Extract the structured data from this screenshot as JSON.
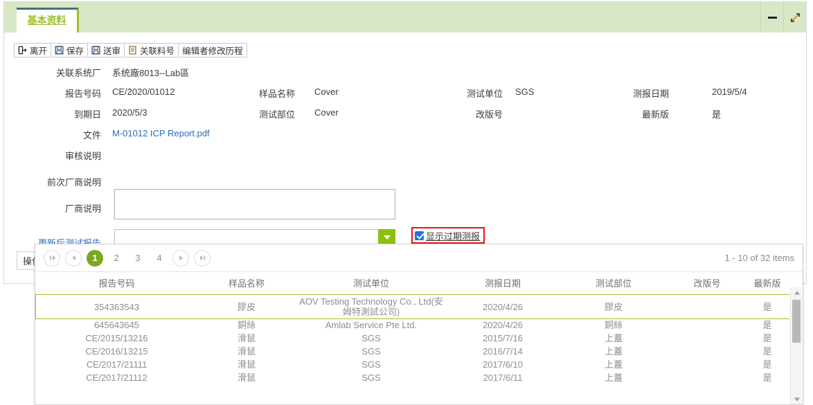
{
  "window": {
    "tab_label": "基本资料",
    "minimize_title": "最小化",
    "maximize_title": "最大化"
  },
  "toolbar": [
    {
      "icon": "exit-icon",
      "label": "离开"
    },
    {
      "icon": "save-icon",
      "label": "保存"
    },
    {
      "icon": "submit-icon",
      "label": "送审"
    },
    {
      "icon": "document-icon",
      "label": "关联料号"
    },
    {
      "icon": "history-icon",
      "label": "编辑者修改历程"
    }
  ],
  "form": {
    "system_factory_label": "关联系统厂",
    "system_factory_value": "系统廠8013--Lab區",
    "report_no_label": "报告号码",
    "report_no_value": "CE/2020/01012",
    "sample_name_label": "样品名称",
    "sample_name_value": "Cover",
    "test_lab_label": "测试单位",
    "test_lab_value": "SGS",
    "report_date_label": "测报日期",
    "report_date_value": "2019/5/4",
    "expiry_label": "到期日",
    "expiry_value": "2020/5/3",
    "test_part_label": "测试部位",
    "test_part_value": "Cover",
    "revision_label": "改版号",
    "revision_value": "",
    "latest_label": "最新版",
    "latest_value": "是",
    "file_label": "文件",
    "file_value": "M-01012 ICP Report.pdf",
    "audit_note_label": "审核说明",
    "audit_note_value": "",
    "prev_vendor_note_label": "前次厂商说明",
    "prev_vendor_note_value": "",
    "vendor_note_label": "厂商说明",
    "vendor_note_value": "",
    "updated_report_label": "更新后测试报告",
    "updated_report_value": "",
    "updated_report_placeholder": "",
    "show_expired_label": "显示过期测报",
    "show_expired_checked": true,
    "ops_label": "操作"
  },
  "dropdown": {
    "pager": {
      "first_icon": "first-page-icon",
      "prev_icon": "prev-page-icon",
      "next_icon": "next-page-icon",
      "last_icon": "last-page-icon",
      "pages": [
        "1",
        "2",
        "3",
        "4"
      ],
      "active_page": "1",
      "info": "1 - 10 of 32 items"
    },
    "grid": {
      "columns": [
        "报告号码",
        "样品名称",
        "测试单位",
        "测报日期",
        "测试部位",
        "改版号",
        "最新版"
      ],
      "rows": [
        {
          "selected": true,
          "cells": [
            "354363543",
            "膠皮",
            "AOV Testing Technology Co., Ltd(安姆特測試公司)",
            "2020/4/26",
            "膠皮",
            "",
            "是"
          ]
        },
        {
          "selected": false,
          "cells": [
            "645643645",
            "銅絲",
            "Amlab Service Pte Ltd.",
            "2020/4/26",
            "銅絲",
            "",
            "是"
          ]
        },
        {
          "selected": false,
          "cells": [
            "CE/2015/13216",
            "滑鼠",
            "SGS",
            "2015/7/16",
            "上蓋",
            "",
            "是"
          ]
        },
        {
          "selected": false,
          "cells": [
            "CE/2016/13215",
            "滑鼠",
            "SGS",
            "2016/7/14",
            "上蓋",
            "",
            "是"
          ]
        },
        {
          "selected": false,
          "cells": [
            "CE/2017/21111",
            "滑鼠",
            "SGS",
            "2017/6/10",
            "上蓋",
            "",
            "是"
          ]
        },
        {
          "selected": false,
          "cells": [
            "CE/2017/21112",
            "滑鼠",
            "SGS",
            "2017/6/11",
            "上蓋",
            "",
            "是"
          ]
        }
      ]
    }
  },
  "colors": {
    "header_band": "#d8e8c6",
    "tab_text": "#9dbf2c",
    "tab_top_border": "#46707e",
    "accent_green": "#8cc010",
    "pager_active": "#7aa81e",
    "highlight_red": "#e8140f",
    "link_blue": "#2b6cb8",
    "checkbox_blue": "#1a73e8"
  }
}
